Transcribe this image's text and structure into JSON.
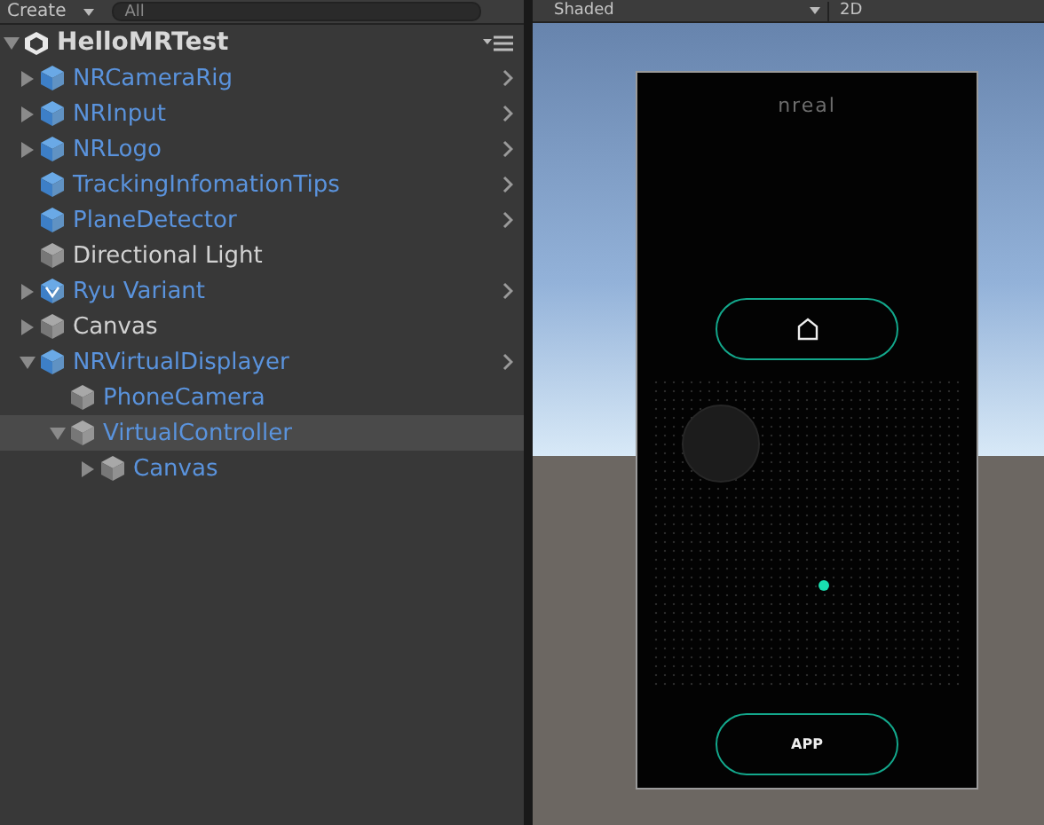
{
  "hierarchy": {
    "toolbar": {
      "create": "Create",
      "search": {
        "placeholder": "All"
      }
    },
    "scene": {
      "name": "HelloMRTest",
      "expanded": true,
      "children": [
        {
          "name": "NRCameraRig",
          "kind": "prefab",
          "expanded": false,
          "selected": false,
          "open_arrow": true
        },
        {
          "name": "NRInput",
          "kind": "prefab",
          "expanded": false,
          "selected": false,
          "open_arrow": true
        },
        {
          "name": "NRLogo",
          "kind": "prefab",
          "expanded": false,
          "selected": false,
          "open_arrow": true
        },
        {
          "name": "TrackingInfomationTips",
          "kind": "prefab",
          "selected": false,
          "open_arrow": true
        },
        {
          "name": "PlaneDetector",
          "kind": "prefab",
          "selected": false,
          "open_arrow": true
        },
        {
          "name": "Directional Light",
          "kind": "object",
          "selected": false,
          "open_arrow": false
        },
        {
          "name": "Ryu Variant",
          "kind": "variant",
          "expanded": false,
          "selected": false,
          "open_arrow": true
        },
        {
          "name": "Canvas",
          "kind": "object",
          "expanded": false,
          "selected": false,
          "open_arrow": false
        },
        {
          "name": "NRVirtualDisplayer",
          "kind": "prefab",
          "expanded": true,
          "selected": false,
          "open_arrow": true,
          "children": [
            {
              "name": "PhoneCamera",
              "kind": "member",
              "selected": false,
              "open_arrow": false
            },
            {
              "name": "VirtualController",
              "kind": "member",
              "expanded": true,
              "selected": true,
              "open_arrow": false,
              "children": [
                {
                  "name": "Canvas",
                  "kind": "member",
                  "expanded": false,
                  "selected": false,
                  "open_arrow": false
                }
              ]
            }
          ]
        }
      ]
    }
  },
  "scene_view": {
    "toolbar": {
      "shading": "Shaded",
      "mode_2d": "2D"
    },
    "phone": {
      "logo": "nreal",
      "app_button": "APP"
    }
  }
}
